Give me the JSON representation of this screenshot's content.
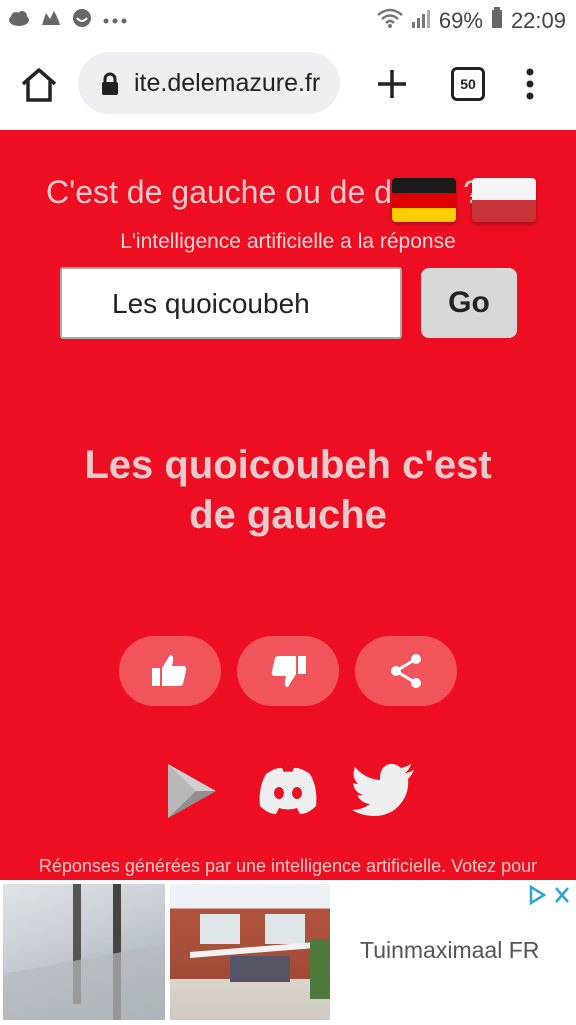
{
  "status_bar": {
    "battery": "69%",
    "time": "22:09"
  },
  "browser": {
    "url": "ite.delemazure.fr",
    "tab_count": "50"
  },
  "page": {
    "title": "C'est de gauche ou de droite ?",
    "subtitle": "L'intelligence artificielle a la réponse",
    "search_value": "Les quoicoubeh",
    "go_label": "Go",
    "answer_line1": "Les quoicoubeh c'est",
    "answer_line2": "de gauche",
    "footer_text": "Réponses générées par une intelligence artificielle. Votez pour"
  },
  "ad": {
    "advertiser": "Tuinmaximaal FR"
  },
  "colors": {
    "background": "#ed0f21",
    "button": "#f2545c"
  }
}
